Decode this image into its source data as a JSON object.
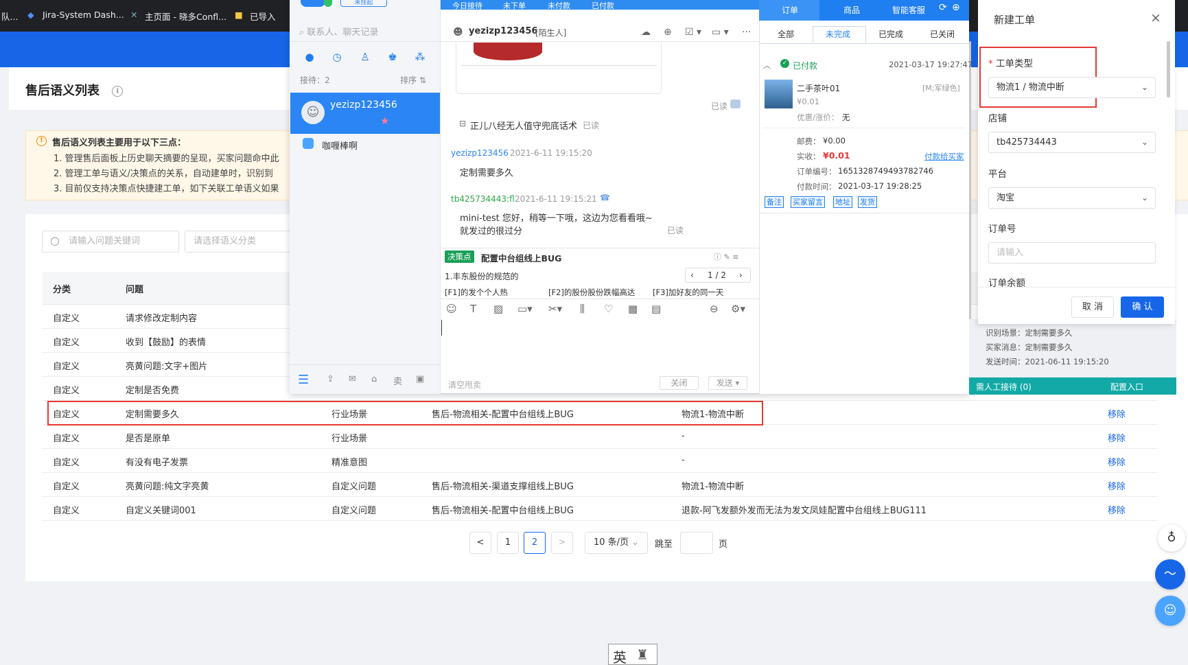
{
  "bookmarks": [
    "队...",
    "Jira-System Dash...",
    "主页面 - 晓多Confl...",
    "已导入"
  ],
  "page": {
    "title": "售后语义列表",
    "notice_title": "售后语义列表主要用于以下三点：",
    "notice_lines": [
      "1. 管理售后面板上历史聊天摘要的呈现，买家问题命中此",
      "2. 管理工单与语义/决策点的关系，自动建单时，识别到",
      "3. 目前仅支持决策点快捷建工单，如下关联工单语义如果"
    ],
    "search_placeholder": "请输入问题关键词",
    "category_placeholder": "请选择语义分类",
    "columns": [
      "分类",
      "问题"
    ],
    "rows": [
      {
        "cat": "自定义",
        "q": "请求修改定制内容",
        "type": "",
        "decision": "",
        "ticket": "",
        "action": ""
      },
      {
        "cat": "自定义",
        "q": "收到【鼓励】的表情",
        "type": "",
        "decision": "",
        "ticket": "",
        "action": ""
      },
      {
        "cat": "自定义",
        "q": "亮黄问题:文字+图片",
        "type": "",
        "decision": "",
        "ticket": "",
        "action": ""
      },
      {
        "cat": "自定义",
        "q": "定制是否免费",
        "type": "",
        "decision": "",
        "ticket": "",
        "action": ""
      },
      {
        "cat": "自定义",
        "q": "定制需要多久",
        "type": "行业场景",
        "decision": "售后-物流相关-配置中台组线上BUG",
        "ticket": "物流1-物流中断",
        "action": "移除"
      },
      {
        "cat": "自定义",
        "q": "是否是原单",
        "type": "行业场景",
        "decision": "",
        "ticket": "-",
        "action": "移除"
      },
      {
        "cat": "自定义",
        "q": "有没有电子发票",
        "type": "精准意图",
        "decision": "",
        "ticket": "-",
        "action": "移除"
      },
      {
        "cat": "自定义",
        "q": "亮黄问题:纯文字亮黄",
        "type": "自定义问题",
        "decision": "售后-物流相关-渠道支撑组线上BUG",
        "ticket": "物流1-物流中断",
        "action": "移除"
      },
      {
        "cat": "自定义",
        "q": "自定义关键词001",
        "type": "自定义问题",
        "decision": "售后-物流相关-配置中台组线上BUG",
        "ticket": "退款-阿飞发额外发而无法为发文凤娃配置中台组线上BUG111",
        "action": "移除"
      }
    ],
    "pagination": {
      "prev": "<",
      "p1": "1",
      "p2": "2",
      "next": ">",
      "size": "10 条/页",
      "jump_label": "跳至",
      "page_unit": "页"
    }
  },
  "chat": {
    "status": "未挂起",
    "search_placeholder": "联系人、聊天记录",
    "reception_count": "接待：2",
    "sort_label": "排序",
    "contacts": [
      {
        "name": "yezizp123456"
      },
      {
        "name": "咖喱棒啊"
      }
    ],
    "top_stats": [
      "今日接待",
      "未下单",
      "未付款",
      "已付款"
    ],
    "header_name": "yezizp123456",
    "header_tag": "[陌生人]",
    "read1": "已读",
    "msg_sys": "正儿八经无人值守兜底话术",
    "msg_sys_read": "已读",
    "msg1_user": "yezizp123456",
    "msg1_time": "2021-6-11 19:15:20",
    "msg1_text": "定制需要多久",
    "msg2_user": "tb425734443:fl",
    "msg2_time": "2021-6-11 19:15:21",
    "msg2_text1": "mini-test 您好，稍等一下哦，这边为您看看哦~",
    "msg2_text2": "就发过的很过分",
    "msg2_read": "已读",
    "decision_tag": "决策点",
    "decision_title": "配置中台组线上BUG",
    "decision_q": "1.丰东股份的规范的",
    "decision_page": "1 / 2",
    "quick": [
      "[F1]的发个个人热",
      "[F2]的股份股份跌幅高达",
      "[F3]加好友的同一天"
    ],
    "clear_label": "清空甩卖",
    "close_label": "关闭",
    "send_label": "发送"
  },
  "order": {
    "tabs_top": [
      "订单",
      "商品",
      "智能客服"
    ],
    "tabs": [
      "全部",
      "未完成",
      "已完成",
      "已关闭"
    ],
    "status": "已付款",
    "time": "2021-03-17 19:27:47",
    "item_name": "二手茶叶01",
    "item_sku": "[M;军绿色]",
    "item_price": "¥0.01",
    "discount_label": "优惠/涨价：",
    "discount_val": "无",
    "postage_label": "邮费：",
    "postage_val": "¥0.00",
    "paid_label": "实收：",
    "paid_val": "¥0.01",
    "paid_link": "付款给买家",
    "order_no_label": "订单编号：",
    "order_no": "1651328749493782746",
    "pay_time_label": "付款时间：",
    "pay_time": "2021-03-17 19:28:25",
    "tags": [
      "备注",
      "买家留言",
      "地址",
      "发货"
    ]
  },
  "drawer": {
    "title": "新建工单",
    "ticket_type_label": "工单类型",
    "ticket_type_val": "物流1 / 物流中断",
    "shop_label": "店铺",
    "shop_val": "tb425734443",
    "platform_label": "平台",
    "platform_val": "淘宝",
    "order_label": "订单号",
    "order_placeholder": "请输入",
    "amount_label": "订单余额",
    "cancel": "取 消",
    "confirm": "确 认",
    "under_lines": [
      "识别场景：定制需要多久",
      "买家消息：定制需要多久",
      "发送时间：2021-06-11 19:15:20"
    ],
    "human_label": "需人工接待 (0)",
    "config_label": "配置入口"
  },
  "ime": "英",
  "colors": {
    "accent": "#1766e8",
    "danger": "#e53935",
    "chat_blue": "#2b85f4"
  }
}
